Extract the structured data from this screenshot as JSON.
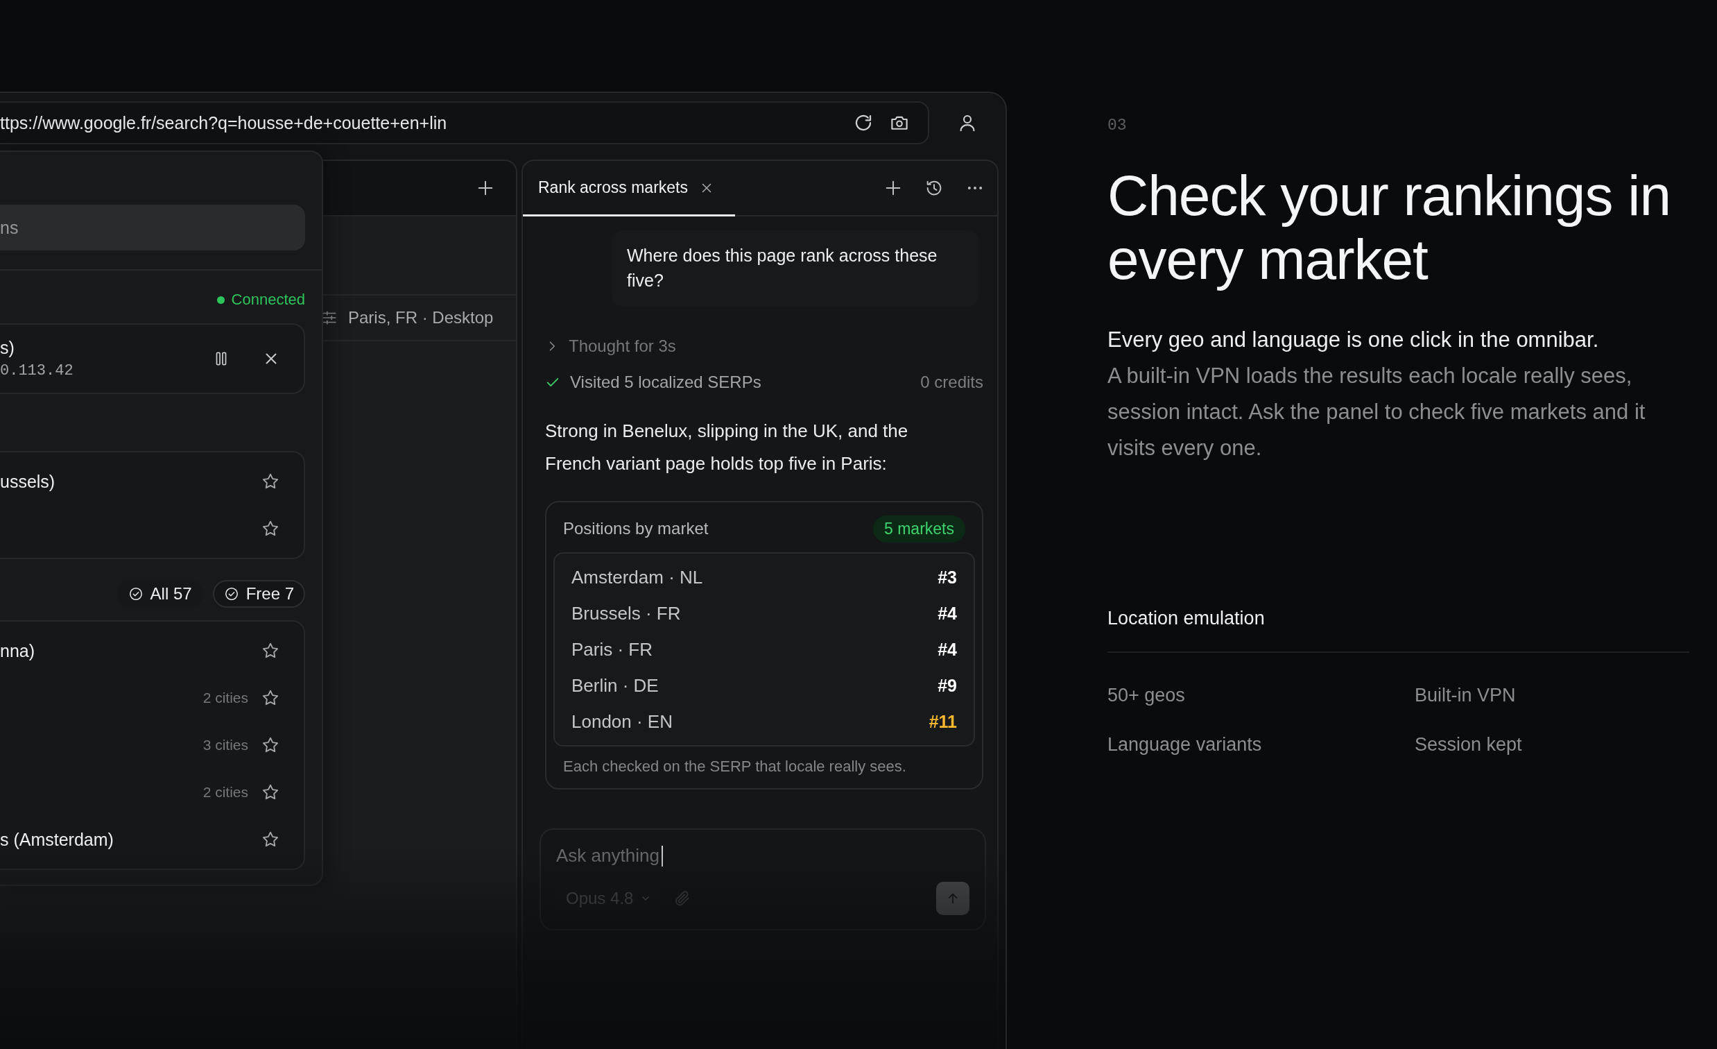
{
  "browser": {
    "url": "ttps://www.google.fr/search?q=housse+de+couette+en+lin"
  },
  "location_menu": {
    "search": {
      "placeholder": "ns"
    },
    "status": {
      "label": "Connected",
      "connected": true
    },
    "active_connection": {
      "name": "s)",
      "ip": "0.113.42"
    },
    "favorites": [
      {
        "label": "ussels)",
        "starred": false
      },
      {
        "starred": false
      }
    ],
    "filters": [
      {
        "label": "All 57",
        "selected": false
      },
      {
        "label": "Free 7",
        "selected": true
      }
    ],
    "countries": [
      {
        "label": "nna)",
        "starred": false
      },
      {
        "count": "2 cities",
        "starred": false
      },
      {
        "count": "3 cities",
        "starred": false
      },
      {
        "count": "2 cities",
        "starred": false
      },
      {
        "label": "s (Amsterdam)",
        "starred": false
      }
    ]
  },
  "page": {
    "location": "Paris, FR · Desktop"
  },
  "chat": {
    "tabs": [
      {
        "label": "Rank across markets",
        "selected": true
      }
    ],
    "user_message": "Where does this page rank across these five?",
    "steps": [
      {
        "kind": "thought",
        "label": "Thought for 3s"
      },
      {
        "kind": "done",
        "label": "Visited 5 localized SERPs",
        "meta": "0 credits"
      }
    ],
    "answer": "Strong in Benelux, slipping in the UK, and the French variant page holds top five in Paris:",
    "result_card": {
      "title": "Positions by market",
      "badge": "5 markets",
      "rows": [
        {
          "market": "Amsterdam · NL",
          "rank": "#3",
          "color": "#ffffff"
        },
        {
          "market": "Brussels · FR",
          "rank": "#4",
          "color": "#ffffff"
        },
        {
          "market": "Paris · FR",
          "rank": "#4",
          "color": "#ffffff"
        },
        {
          "market": "Berlin · DE",
          "rank": "#9",
          "color": "#ffffff"
        },
        {
          "market": "London · EN",
          "rank": "#11",
          "color": "#f5b82e"
        }
      ],
      "footnote": "Each checked on the SERP that locale really sees."
    },
    "composer": {
      "placeholder": "Ask anything",
      "model": "Opus 4.8"
    }
  },
  "intro": {
    "index": "03",
    "heading": "Check your rankings in every market",
    "lead": "Every geo and language is one click in the omnibar.",
    "body": "A built-in VPN loads the results each locale really sees, session intact. Ask the panel to check five markets and it visits every one.",
    "features_title": "Location emulation",
    "features": [
      "50+ geos",
      "Built-in VPN",
      "Language variants",
      "Session kept"
    ]
  }
}
